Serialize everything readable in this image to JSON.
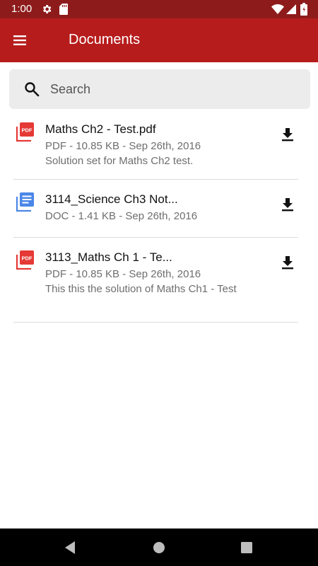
{
  "status_bar": {
    "time": "1:00",
    "icons": [
      "gear-icon",
      "sd-card-icon",
      "wifi-icon",
      "signal-icon",
      "battery-icon"
    ]
  },
  "app_bar": {
    "title": "Documents",
    "menu_icon": "menu-icon",
    "background_color": "#b71c1c",
    "status_color": "#8e1b1b"
  },
  "search": {
    "placeholder": "Search",
    "value": ""
  },
  "documents": [
    {
      "title": "Maths Ch2 - Test.pdf",
      "type": "PDF",
      "meta": "PDF - 10.85 KB - Sep 26th, 2016",
      "description": "Solution set for Maths Ch2 test.",
      "type_icon": "pdf-icon",
      "action_icon": "download-icon"
    },
    {
      "title": "3114_Science Ch3 Not...",
      "type": "DOC",
      "meta": "DOC - 1.41 KB - Sep 26th, 2016",
      "description": "",
      "type_icon": "doc-icon",
      "action_icon": "download-icon"
    },
    {
      "title": "3113_Maths Ch 1 - Te...",
      "type": "PDF",
      "meta": "PDF - 10.85 KB - Sep 26th, 2016",
      "description": "This this the solution of Maths Ch1 - Test",
      "type_icon": "pdf-icon",
      "action_icon": "download-icon"
    }
  ],
  "pdf_icon_label": "PDF",
  "nav_bar": {
    "icons": [
      "back-icon",
      "home-icon",
      "recents-icon"
    ]
  },
  "colors": {
    "pdf_red": "#e53935",
    "doc_blue": "#4a86e8"
  }
}
